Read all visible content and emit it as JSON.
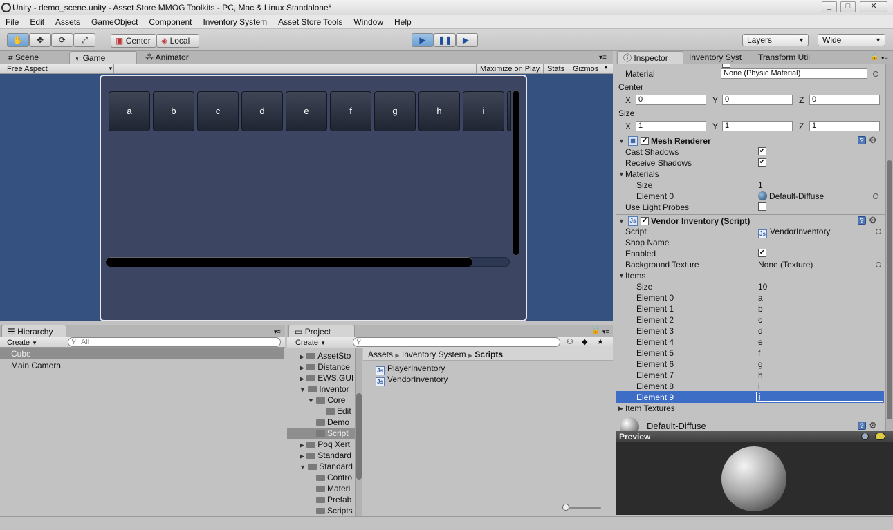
{
  "window": {
    "title": "Unity - demo_scene.unity - Asset Store MMOG Toolkits - PC, Mac & Linux Standalone*",
    "controls": [
      "_",
      "□",
      "✕"
    ]
  },
  "menu": [
    "File",
    "Edit",
    "Assets",
    "GameObject",
    "Component",
    "Inventory System",
    "Asset Store Tools",
    "Window",
    "Help"
  ],
  "toolbar": {
    "pivot_label": "Center",
    "space_label": "Local",
    "layers_label": "Layers",
    "layout_label": "Wide"
  },
  "scene_tabs": {
    "scene": "Scene",
    "game": "Game",
    "animator": "Animator"
  },
  "game_bar": {
    "aspect": "Free Aspect",
    "maximize": "Maximize on Play",
    "stats": "Stats",
    "gizmos": "Gizmos"
  },
  "game_buttons": [
    "a",
    "b",
    "c",
    "d",
    "e",
    "f",
    "g",
    "h",
    "i"
  ],
  "hierarchy": {
    "tab": "Hierarchy",
    "create": "Create",
    "search_placeholder": "All",
    "items": [
      "Cube",
      "Main Camera"
    ]
  },
  "project": {
    "tab": "Project",
    "create": "Create",
    "tree": [
      "AssetSto",
      "Distance",
      "EWS.GUI",
      "Inventor",
      "Core",
      "Edit",
      "Demo",
      "Script",
      "Poq Xert",
      "Standard",
      "Standard",
      "Contro",
      "Materi",
      "Prefab",
      "Scripts"
    ],
    "breadcrumb": [
      "Assets",
      "Inventory System",
      "Scripts"
    ],
    "files": [
      "PlayerInventory",
      "VendorInventory"
    ]
  },
  "inspector": {
    "tabs": [
      "Inspector",
      "Inventory Syst",
      "Transform Util"
    ],
    "collider": {
      "material_label": "Material",
      "material_value": "None (Physic Material)",
      "center_label": "Center",
      "center": {
        "x": "0",
        "y": "0",
        "z": "0"
      },
      "size_label": "Size",
      "size": {
        "x": "1",
        "y": "1",
        "z": "1"
      },
      "axis_labels": [
        "X",
        "Y",
        "Z"
      ]
    },
    "mesh_renderer": {
      "title": "Mesh Renderer",
      "cast_shadows": "Cast Shadows",
      "receive_shadows": "Receive Shadows",
      "materials": "Materials",
      "size_label": "Size",
      "size_value": "1",
      "element0_label": "Element 0",
      "element0_value": "Default-Diffuse",
      "light_probes": "Use Light Probes"
    },
    "vendor": {
      "title": "Vendor Inventory (Script)",
      "script_label": "Script",
      "script_value": "VendorInventory",
      "shop_name": "Shop Name",
      "enabled": "Enabled",
      "bg_label": "Background Texture",
      "bg_value": "None (Texture)",
      "items_label": "Items",
      "size_label": "Size",
      "size_value": "10",
      "elements": [
        {
          "label": "Element 0",
          "value": "a"
        },
        {
          "label": "Element 1",
          "value": "b"
        },
        {
          "label": "Element 2",
          "value": "c"
        },
        {
          "label": "Element 3",
          "value": "d"
        },
        {
          "label": "Element 4",
          "value": "e"
        },
        {
          "label": "Element 5",
          "value": "f"
        },
        {
          "label": "Element 6",
          "value": "g"
        },
        {
          "label": "Element 7",
          "value": "h"
        },
        {
          "label": "Element 8",
          "value": "i"
        },
        {
          "label": "Element 9",
          "value": "j"
        }
      ],
      "item_textures": "Item Textures"
    },
    "material_name": "Default-Diffuse",
    "preview_label": "Preview"
  },
  "colors": {
    "game_bg": "#345180",
    "panel_bg": "#3c4663",
    "selection": "#3d6dc5"
  }
}
